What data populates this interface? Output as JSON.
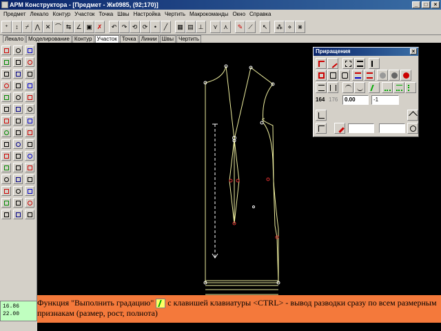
{
  "window": {
    "title": "АРМ Конструктора - [Предмет - Жк0985, (92;170)]"
  },
  "menu": [
    "Предмет",
    "Лекало",
    "Контур",
    "Участок",
    "Точка",
    "Швы",
    "Настройка",
    "Чертить",
    "Макрокоманды",
    "Окно",
    "Справка"
  ],
  "tabs": [
    {
      "label": "Лекало",
      "active": false
    },
    {
      "label": "Моделирование",
      "active": false
    },
    {
      "label": "Контур",
      "active": false
    },
    {
      "label": "Участок",
      "active": true
    },
    {
      "label": "Точка",
      "active": false
    },
    {
      "label": "Линии",
      "active": false
    },
    {
      "label": "Швы",
      "active": false
    },
    {
      "label": "Чертить",
      "active": false
    }
  ],
  "coords": {
    "line1": "16.86",
    "line2": "22.00"
  },
  "panel": {
    "title": "Приращения",
    "close": "×",
    "size_a": "164",
    "size_b": "176",
    "value": "0.00",
    "increment": "-1"
  },
  "caption": {
    "part1": "Функция \"Выполнить градацию\"",
    "part2": "с клавишей клавиатуры <CTRL> - вывод разводки сразу по всем размерным признакам (размер, рост, полнота)"
  },
  "colors": {
    "canvas_bg": "#000000",
    "pattern_line": "#f0f0a0",
    "accent_red": "#e03030",
    "caption_bg": "#f4793b"
  }
}
